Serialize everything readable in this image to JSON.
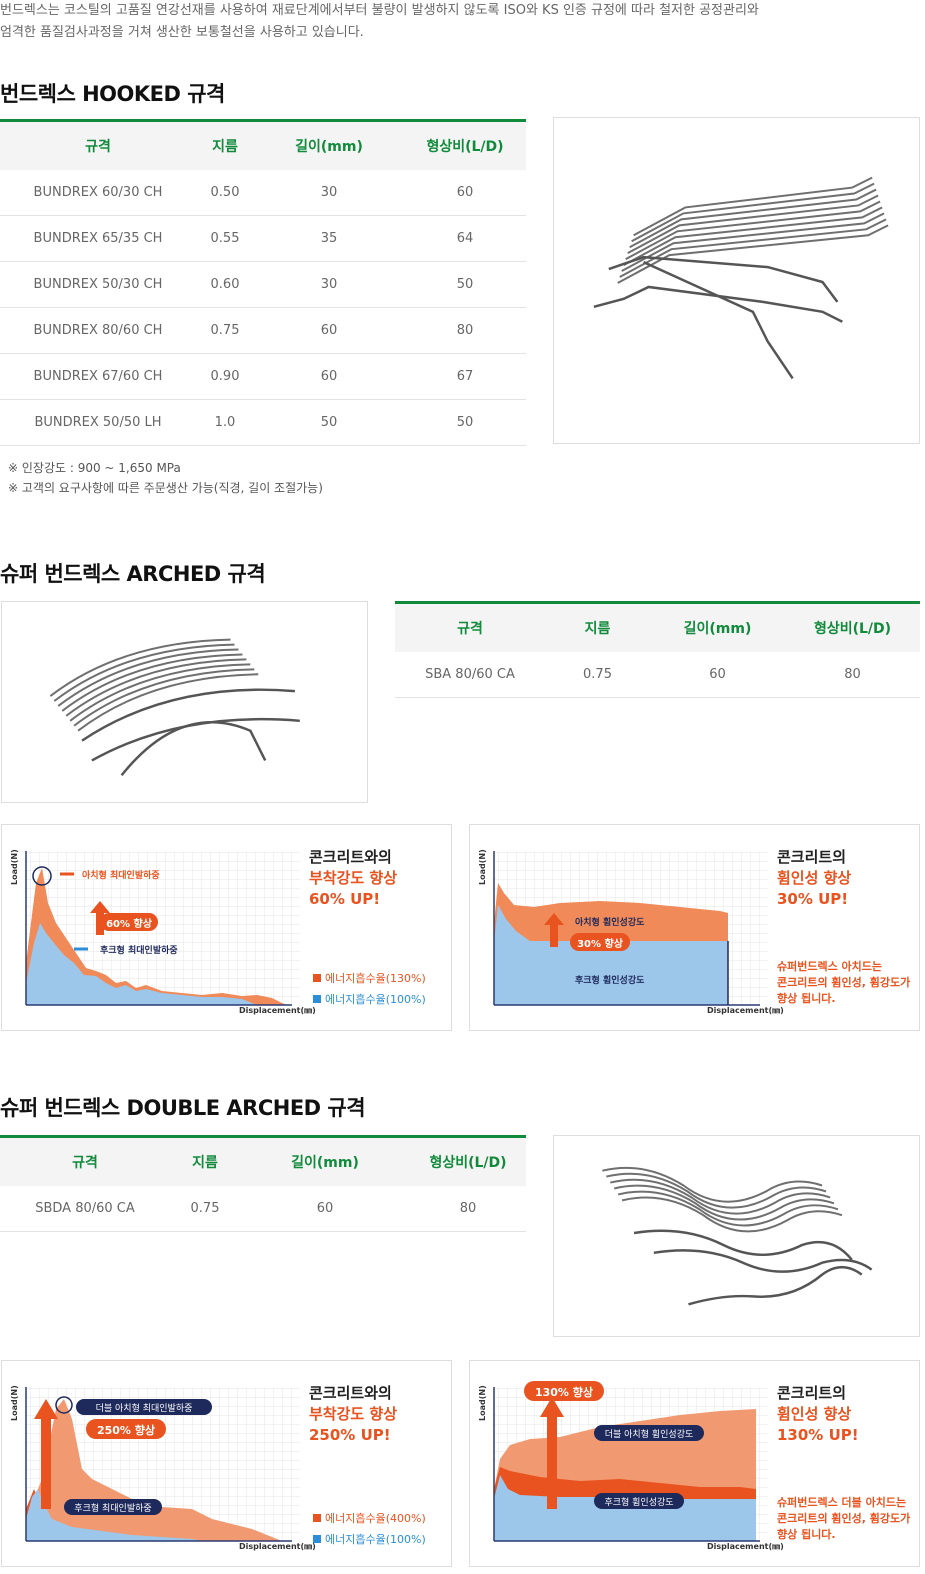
{
  "intro": {
    "line1": "번드렉스는 코스틸의 고품질 연강선재를 사용하여 재료단계에서부터 불량이 발생하지 않도록 ISO와 KS 인증 규정에 따라 철저한 공정관리와",
    "line2": "엄격한 품질검사과정을 거쳐 생산한 보통철선을 사용하고 있습니다."
  },
  "headers": {
    "spec": "규격",
    "dia": "지름",
    "len": "길이(mm)",
    "ratio": "형상비(L/D)"
  },
  "hooked": {
    "title": "번드렉스 HOOKED 규격",
    "rows": [
      [
        "BUNDREX 60/30 CH",
        "0.50",
        "30",
        "60"
      ],
      [
        "BUNDREX 65/35 CH",
        "0.55",
        "35",
        "64"
      ],
      [
        "BUNDREX 50/30 CH",
        "0.60",
        "30",
        "50"
      ],
      [
        "BUNDREX 80/60 CH",
        "0.75",
        "60",
        "80"
      ],
      [
        "BUNDREX 67/60 CH",
        "0.90",
        "60",
        "67"
      ],
      [
        "BUNDREX 50/50 LH",
        "1.0",
        "50",
        "50"
      ]
    ],
    "note1": "※ 인장강도 : 900 ~ 1,650 MPa",
    "note2": "※ 고객의 요구사항에 따른 주문생산 가능(직경, 길이 조절가능)"
  },
  "arched": {
    "title": "슈퍼 번드렉스 ARCHED 규격",
    "rows": [
      [
        "SBA 80/60 CA",
        "0.75",
        "60",
        "80"
      ]
    ]
  },
  "double": {
    "title": "슈퍼 번드렉스 DOUBLE ARCHED 규격",
    "rows": [
      [
        "SBDA 80/60 CA",
        "0.75",
        "60",
        "80"
      ]
    ]
  },
  "charts": {
    "y_label": "Load(N)",
    "x_label": "Displacement(㎜)",
    "c1": {
      "head": "콘크리트와의",
      "accent1": "부착강도 향상",
      "accent2": "60% UP!",
      "peak_label": "아치형 최대인발하중",
      "base_label": "후크형 최대인발하중",
      "badge": "60% 향상",
      "legend1": "에너지흡수율(130%)",
      "legend2": "에너지흡수율(100%)"
    },
    "c2": {
      "head": "콘크리트의",
      "accent1": "휨인성 향상",
      "accent2": "30% UP!",
      "top_label": "아치형 휨인성강도",
      "bottom_label": "후크형 휨인성강도",
      "badge": "30% 향상",
      "desc1": "슈퍼번드렉스 아치드는",
      "desc2": "콘크리트의 휨인성, 휨강도가",
      "desc3": "향상 됩니다."
    },
    "c3": {
      "head": "콘크리트와의",
      "accent1": "부착강도 향상",
      "accent2": "250% UP!",
      "peak_label": "더블 아치형 최대인발하중",
      "base_label": "후크형 최대인발하중",
      "badge": "250% 향상",
      "legend1": "에너지흡수율(400%)",
      "legend2": "에너지흡수율(100%)"
    },
    "c4": {
      "head": "콘크리트의",
      "accent1": "휨인성 향상",
      "accent2": "130% UP!",
      "top_label": "더블 아치형 휨인성강도",
      "bottom_label": "후크형 휨인성강도",
      "badge": "130% 향상",
      "desc1": "슈퍼번드렉스 더블 아치드는",
      "desc2": "콘크리트의 휨인성, 휨강도가",
      "desc3": "향상 됩니다."
    }
  },
  "colors": {
    "green": "#128a3c",
    "orange": "#e8531f",
    "blue": "#2a8fd8",
    "navy": "#1f2a5c"
  }
}
